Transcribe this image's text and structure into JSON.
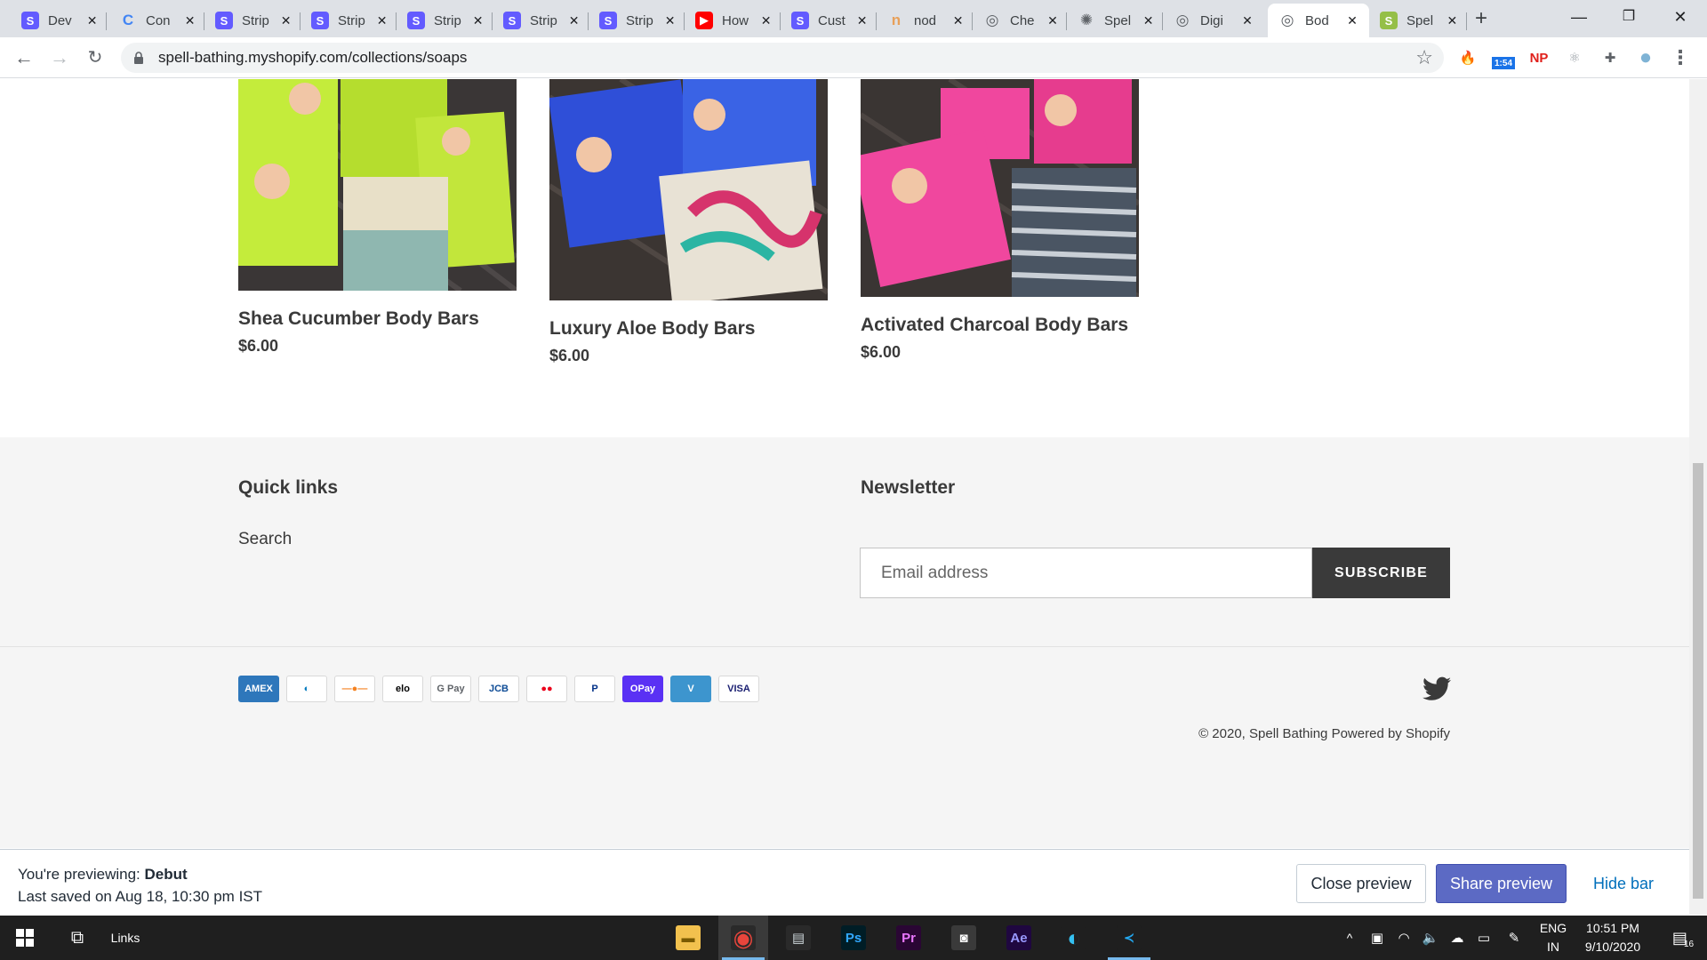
{
  "browser": {
    "tabs": [
      {
        "label": "Dev",
        "icon": "stripe-icon",
        "color": "#635bff",
        "glyph": "S"
      },
      {
        "label": "Con",
        "icon": "colorful-logo-icon",
        "color": "#ffffff",
        "glyph": "C"
      },
      {
        "label": "Strip",
        "icon": "stripe-icon",
        "color": "#635bff",
        "glyph": "S"
      },
      {
        "label": "Strip",
        "icon": "stripe-icon",
        "color": "#635bff",
        "glyph": "S"
      },
      {
        "label": "Strip",
        "icon": "stripe-icon",
        "color": "#635bff",
        "glyph": "S"
      },
      {
        "label": "Strip",
        "icon": "stripe-icon",
        "color": "#635bff",
        "glyph": "S"
      },
      {
        "label": "Strip",
        "icon": "stripe-icon",
        "color": "#635bff",
        "glyph": "S"
      },
      {
        "label": "How",
        "icon": "youtube-icon",
        "color": "#ff0000",
        "glyph": "▶"
      },
      {
        "label": "Cust",
        "icon": "stripe-icon",
        "color": "#635bff",
        "glyph": "S"
      },
      {
        "label": "nod",
        "icon": "node-icon",
        "color": "#e8a05a",
        "glyph": "n"
      },
      {
        "label": "Che",
        "icon": "globe-icon",
        "color": "#5f6368",
        "glyph": "◎"
      },
      {
        "label": "Spel",
        "icon": "spell-icon",
        "color": "#5f6368",
        "glyph": "✺"
      },
      {
        "label": "Digi",
        "icon": "globe-icon",
        "color": "#5f6368",
        "glyph": "◎"
      },
      {
        "label": "Bod",
        "icon": "globe-icon",
        "color": "#5f6368",
        "glyph": "◎",
        "active": true
      },
      {
        "label": "Spel",
        "icon": "shopify-icon",
        "color": "#95bf47",
        "glyph": "S"
      }
    ],
    "new_tab": "+",
    "minimize": "—",
    "restore": "❐",
    "close": "✕",
    "url": "spell-bathing.myshopify.com/collections/soaps",
    "extensions": [
      {
        "name": "fire-extension-icon",
        "glyph": "🔥",
        "color": "#e8542c"
      },
      {
        "name": "timer-extension-icon",
        "glyph": "1:54",
        "color": "#1a73e8"
      },
      {
        "name": "np-extension-icon",
        "glyph": "NP",
        "color": "#e0201b"
      },
      {
        "name": "react-extension-icon",
        "glyph": "⚛",
        "color": "#9aa0a6"
      },
      {
        "name": "puzzle-extensions-icon",
        "glyph": "✚",
        "color": "#5f6368"
      },
      {
        "name": "profile-avatar-icon",
        "glyph": "●",
        "color": "#7fb3d5"
      },
      {
        "name": "menu-kebab-icon",
        "glyph": "⋮",
        "color": "#5f6368"
      }
    ]
  },
  "products": [
    {
      "name": "Shea Cucumber Body Bars",
      "price": "$6.00",
      "colors": [
        "#c4ec3b",
        "#b5dd2e",
        "#a6d26f"
      ]
    },
    {
      "name": "Luxury Aloe Body Bars",
      "price": "$6.00",
      "colors": [
        "#2f4fd8",
        "#3a63e5",
        "#e8e2d5"
      ]
    },
    {
      "name": "Activated Charcoal Body Bars",
      "price": "$6.00",
      "colors": [
        "#f0479e",
        "#e63c8e",
        "#4a5563"
      ]
    }
  ],
  "footer": {
    "quick_links_title": "Quick links",
    "search_link": "Search",
    "newsletter_title": "Newsletter",
    "email_placeholder": "Email address",
    "subscribe_label": "SUBSCRIBE",
    "payment_methods": [
      {
        "name": "amex",
        "label": "AMEX",
        "bg": "#2e77bb",
        "fg": "#ffffff"
      },
      {
        "name": "diners-club",
        "label": "◐",
        "bg": "#ffffff",
        "fg": "#0079be"
      },
      {
        "name": "discover",
        "label": "—●—",
        "bg": "#ffffff",
        "fg": "#f58220"
      },
      {
        "name": "elo",
        "label": "elo",
        "bg": "#ffffff",
        "fg": "#000000"
      },
      {
        "name": "google-pay",
        "label": "G Pay",
        "bg": "#ffffff",
        "fg": "#5f6368"
      },
      {
        "name": "jcb",
        "label": "JCB",
        "bg": "#ffffff",
        "fg": "#0e4c96"
      },
      {
        "name": "mastercard",
        "label": "●●",
        "bg": "#ffffff",
        "fg": "#eb001b"
      },
      {
        "name": "paypal",
        "label": "P",
        "bg": "#ffffff",
        "fg": "#003087"
      },
      {
        "name": "shop-pay",
        "label": "OPay",
        "bg": "#5a31f4",
        "fg": "#ffffff"
      },
      {
        "name": "venmo",
        "label": "V",
        "bg": "#3d95ce",
        "fg": "#ffffff"
      },
      {
        "name": "visa",
        "label": "VISA",
        "bg": "#ffffff",
        "fg": "#1a1f71"
      }
    ],
    "copyright_store": "© 2020, Spell Bathing",
    "powered_by": "Powered by Shopify"
  },
  "preview_bar": {
    "previewing_prefix": "You're previewing: ",
    "theme_name": "Debut",
    "last_saved": "Last saved on Aug 18, 10:30 pm IST",
    "close_label": "Close preview",
    "share_label": "Share preview",
    "hide_label": "Hide bar"
  },
  "taskbar": {
    "links_label": "Links",
    "language_line1": "ENG",
    "language_line2": "IN",
    "time": "10:51 PM",
    "date": "9/10/2020",
    "notification_count": "16",
    "apps": [
      {
        "name": "file-explorer-icon",
        "glyph": "▬",
        "bg": "#f2c14e",
        "fg": "#7a5a00"
      },
      {
        "name": "chrome-icon",
        "glyph": "◉",
        "bg": "#2a2a2a",
        "fg": "#e8453c",
        "active": true
      },
      {
        "name": "app-window-icon",
        "glyph": "▤",
        "bg": "#2a2a2a",
        "fg": "#cfd8dc"
      },
      {
        "name": "photoshop-icon",
        "glyph": "Ps",
        "bg": "#001d26",
        "fg": "#31a8ff"
      },
      {
        "name": "premiere-icon",
        "glyph": "Pr",
        "bg": "#2a0634",
        "fg": "#ea77ff"
      },
      {
        "name": "app-terminal-icon",
        "glyph": "◙",
        "bg": "#3a3a3a",
        "fg": "#ffffff"
      },
      {
        "name": "after-effects-icon",
        "glyph": "Ae",
        "bg": "#1f0740",
        "fg": "#9999ff"
      },
      {
        "name": "edge-icon",
        "glyph": "◐",
        "bg": "#1f1f1f",
        "fg": "#35c1f1"
      },
      {
        "name": "vscode-icon",
        "glyph": "≺",
        "bg": "#1f1f1f",
        "fg": "#23a9f2",
        "active": true
      }
    ]
  }
}
